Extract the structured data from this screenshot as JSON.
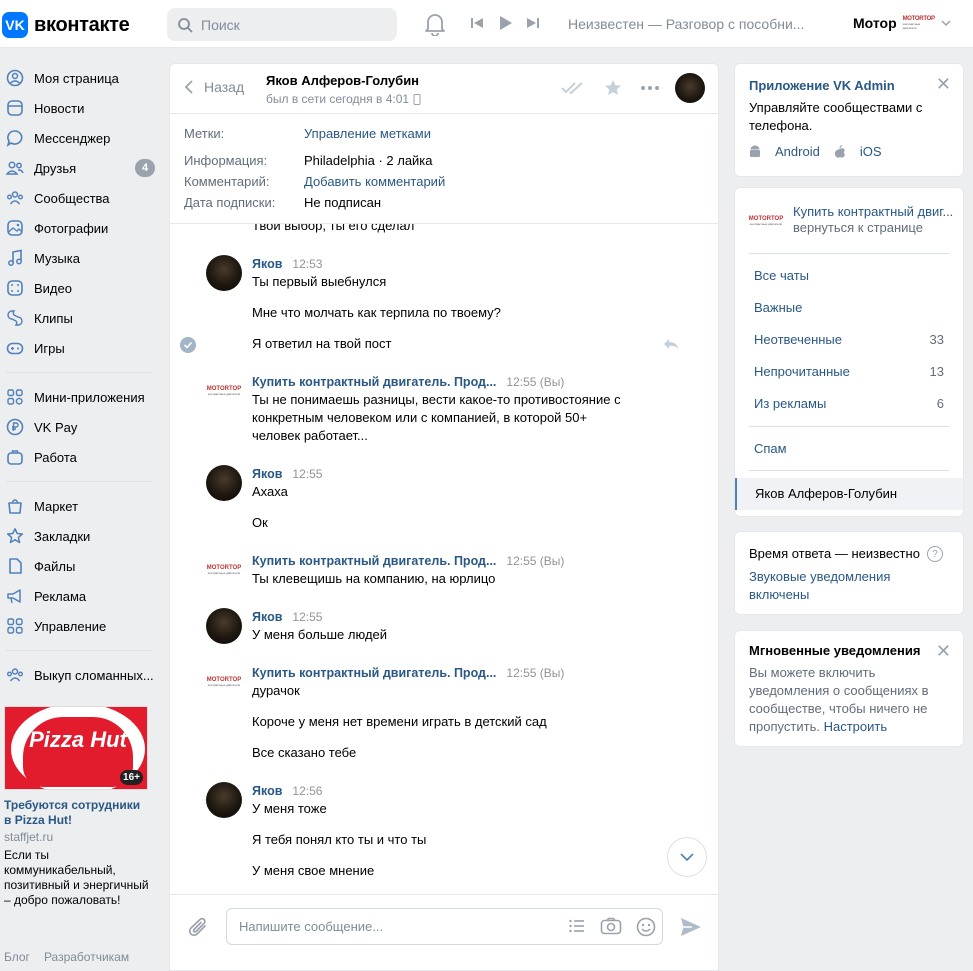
{
  "header": {
    "logo_letter": "VK",
    "logo_text": "вконтакте",
    "search_placeholder": "Поиск",
    "track": "Неизвестен — Разговор с пособни...",
    "user_name": "Мотор",
    "brand_name": "MOTORTOP",
    "brand_tagline": "контрактные двигатели",
    "accent_color": "#0077ff"
  },
  "nav": {
    "items": [
      {
        "label": "Моя страница",
        "icon": "user-circle-icon"
      },
      {
        "label": "Новости",
        "icon": "news-icon"
      },
      {
        "label": "Мессенджер",
        "icon": "message-icon"
      },
      {
        "label": "Друзья",
        "icon": "friends-icon",
        "badge": "4"
      },
      {
        "label": "Сообщества",
        "icon": "communities-icon"
      },
      {
        "label": "Фотографии",
        "icon": "photo-icon"
      },
      {
        "label": "Музыка",
        "icon": "music-icon"
      },
      {
        "label": "Видео",
        "icon": "video-icon"
      },
      {
        "label": "Клипы",
        "icon": "clips-icon"
      },
      {
        "label": "Игры",
        "icon": "gamepad-icon"
      },
      {
        "label": "Мини-приложения",
        "icon": "apps-icon"
      },
      {
        "label": "VK Pay",
        "icon": "ruble-icon"
      },
      {
        "label": "Работа",
        "icon": "briefcase-icon"
      },
      {
        "label": "Маркет",
        "icon": "bag-icon"
      },
      {
        "label": "Закладки",
        "icon": "star-icon"
      },
      {
        "label": "Файлы",
        "icon": "file-icon"
      },
      {
        "label": "Реклама",
        "icon": "megaphone-icon"
      },
      {
        "label": "Управление",
        "icon": "grid-icon"
      },
      {
        "label": "Выкуп сломанных...",
        "icon": "communities-icon"
      }
    ]
  },
  "ad": {
    "logo_text": "Pizza Hut",
    "age": "16+",
    "title": "Требуются сотрудники в Pizza Hut!",
    "domain": "staffjet.ru",
    "text": "Если ты коммуникабельный, позитивный и энергичный – добро пожаловать!"
  },
  "footer": {
    "blog": "Блог",
    "devs": "Разработчикам"
  },
  "chat": {
    "back": "Назад",
    "peer_name": "Яков Алферов-Голубин",
    "peer_status": "был в сети сегодня в 4:01",
    "meta": {
      "tags_key": "Метки:",
      "tags_val": "Управление метками",
      "info_key": "Информация:",
      "info_val": "Philadelphia · 2 лайка",
      "comment_key": "Комментарий:",
      "comment_val": "Добавить комментарий",
      "sub_key": "Дата подписки:",
      "sub_val": "Не подписан"
    },
    "messages": {
      "m0": "Твой выбор, ты его сделал",
      "g1_author": "Яков",
      "g1_time": "12:53",
      "g1_l1": "Ты первый выебнулся",
      "g1_l2": "Мне что молчать как терпила по твоему?",
      "g1_l3": "Я ответил на твой пост",
      "g2_author": "Купить контрактный двигатель. Прод...",
      "g2_time": "12:55 (Вы)",
      "g2_l1": "Ты не понимаешь разницы, вести какое-то противостояние с",
      "g2_l2": "конкретным человеком или с компанией, в которой 50+",
      "g2_l3": "человек работает...",
      "g3_author": "Яков",
      "g3_time": "12:55",
      "g3_l1": "Ахаха",
      "g3_l2": "Ок",
      "g4_author": "Купить контрактный двигатель. Прод...",
      "g4_time": "12:55 (Вы)",
      "g4_l1": "Ты клевещишь на компанию, на юрлицо",
      "g5_author": "Яков",
      "g5_time": "12:55",
      "g5_l1": "У меня больше людей",
      "g6_author": "Купить контрактный двигатель. Прод...",
      "g6_time": "12:55 (Вы)",
      "g6_l1": "дурачок",
      "g6_l2": "Короче у меня нет времени играть в детский сад",
      "g6_l3": "Все сказано тебе",
      "g7_author": "Яков",
      "g7_time": "12:56",
      "g7_l1": "У меня тоже",
      "g7_l2": "Я тебя понял кто ты и что ты",
      "g7_l3": "У меня свое мнение"
    },
    "composer_placeholder": "Напишите сообщение..."
  },
  "right": {
    "admin": {
      "title": "Приложение VK Admin",
      "desc": "Управляйте сообществами с телефона.",
      "android": "Android",
      "ios": "iOS"
    },
    "group": {
      "name": "Купить контрактный двиг...",
      "back": "вернуться к странице"
    },
    "filters": [
      {
        "label": "Все чаты",
        "count": ""
      },
      {
        "label": "Важные",
        "count": ""
      },
      {
        "label": "Неотвеченные",
        "count": "33"
      },
      {
        "label": "Непрочитанные",
        "count": "13"
      },
      {
        "label": "Из рекламы",
        "count": "6"
      },
      {
        "label": "Спам",
        "count": ""
      }
    ],
    "active_chat": "Яков Алферов-Голубин",
    "response": {
      "time": "Время ответа — неизвестно",
      "help": "?",
      "sound": "Звуковые уведомления включены"
    },
    "instant": {
      "title": "Мгновенные уведомления",
      "desc": "Вы можете включить уведомления о сообщениях в сообществе, чтобы ничего не пропустить.",
      "link": "Настроить"
    }
  }
}
